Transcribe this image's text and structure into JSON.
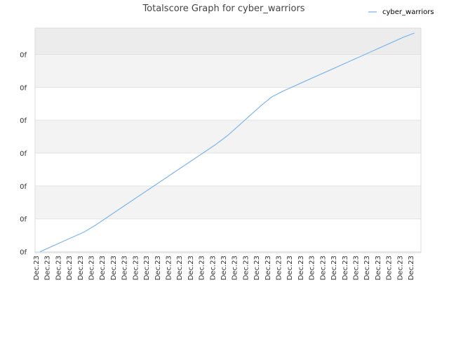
{
  "chart_data": {
    "type": "line",
    "title": "Totalscore Graph for cyber_warriors",
    "xlabel": "",
    "ylabel": "",
    "legend": {
      "position": "top-right"
    },
    "grid": true,
    "y_tick_labels": [
      "0f",
      "0f",
      "0f",
      "0f",
      "0f",
      "0f",
      "0f"
    ],
    "x": [
      "Dec.23",
      "Dec.23",
      "Dec.23",
      "Dec.23",
      "Dec.23",
      "Dec.23",
      "Dec.23",
      "Dec.23",
      "Dec.23",
      "Dec.23",
      "Dec.23",
      "Dec.23",
      "Dec.23",
      "Dec.23",
      "Dec.23",
      "Dec.23",
      "Dec.23",
      "Dec.23",
      "Dec.23",
      "Dec.23",
      "Dec.23",
      "Dec.23",
      "Dec.23",
      "Dec.23",
      "Dec.23",
      "Dec.23",
      "Dec.23",
      "Dec.23",
      "Dec.23",
      "Dec.23",
      "Dec.23",
      "Dec.23",
      "Dec.23",
      "Dec.23",
      "Dec.23"
    ],
    "series": [
      {
        "name": "cyber_warriors",
        "color": "#7cb5ec",
        "values": [
          0.0,
          0.3,
          0.6,
          0.9,
          1.2,
          1.6,
          2.05,
          2.5,
          2.95,
          3.4,
          3.85,
          4.3,
          4.75,
          5.2,
          5.65,
          6.1,
          6.55,
          7.05,
          7.65,
          8.25,
          8.85,
          9.4,
          9.75,
          10.05,
          10.35,
          10.65,
          10.95,
          11.25,
          11.55,
          11.85,
          12.15,
          12.45,
          12.75,
          13.05,
          13.3
        ]
      }
    ],
    "ylim": [
      -0.06,
      13.6
    ],
    "y_ticks": [
      0,
      2,
      4,
      6,
      8,
      10,
      12
    ]
  }
}
